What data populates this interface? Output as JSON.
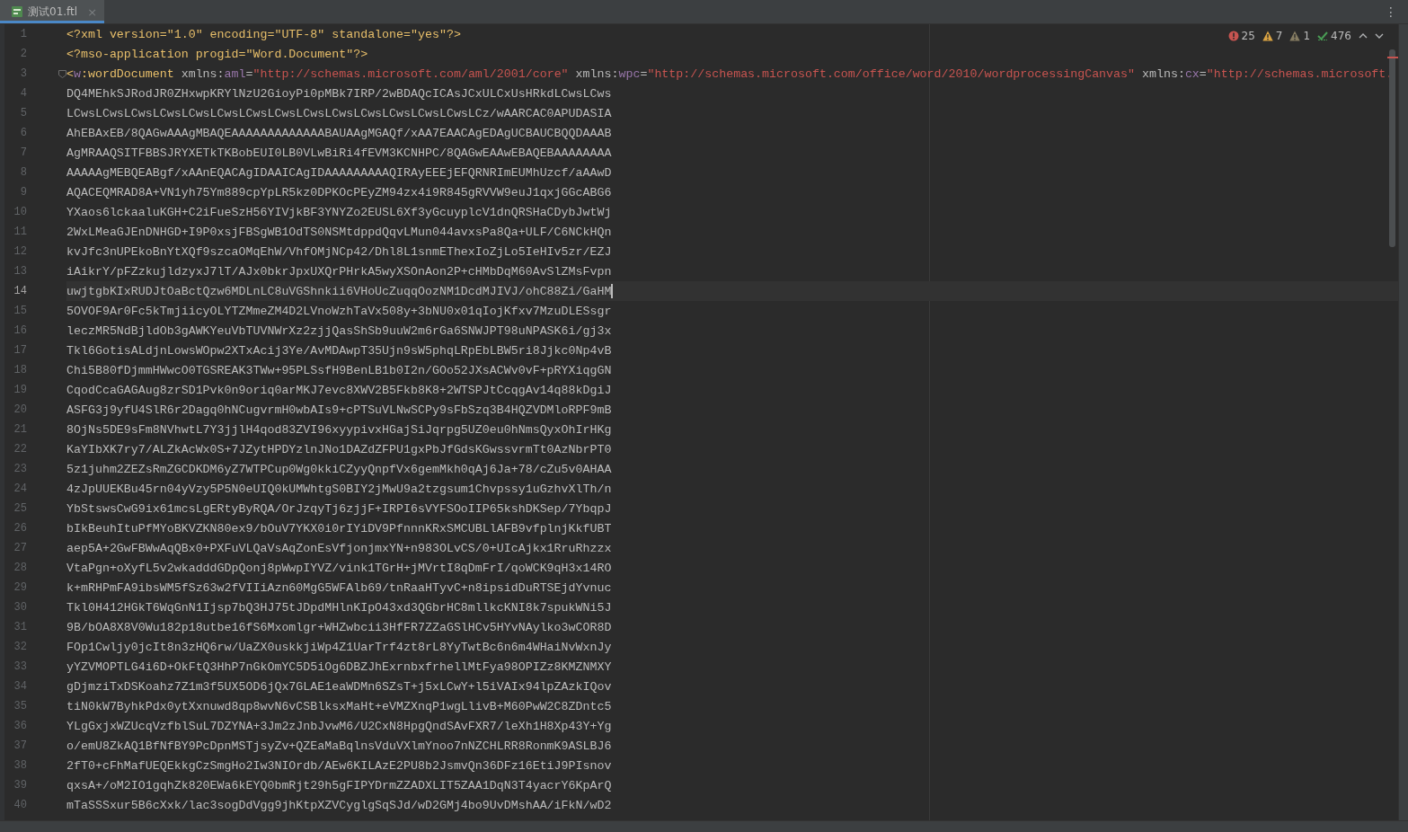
{
  "tabs": [
    {
      "title": "测试01.ftl",
      "selected": true,
      "close": "×"
    }
  ],
  "menu": "⋮",
  "inspections": [
    {
      "kind": "error",
      "count": "25"
    },
    {
      "kind": "warning",
      "count": "7"
    },
    {
      "kind": "weak",
      "count": "1"
    },
    {
      "kind": "ok",
      "count": "476"
    }
  ],
  "lines": [
    {
      "number": "1",
      "current": false,
      "tokens": [
        {
          "kind": "pi",
          "text": "<?xml version=\"1.0\" encoding=\"UTF-8\" standalone=\"yes\"?>"
        }
      ]
    },
    {
      "number": "2",
      "current": false,
      "tokens": [
        {
          "kind": "pi",
          "text": "<?mso-application progid=\"Word.Document\"?>"
        }
      ]
    },
    {
      "number": "3",
      "current": false,
      "fold": true,
      "tokens": [
        {
          "kind": "tag",
          "text": "<"
        },
        {
          "kind": "ns",
          "text": "w"
        },
        {
          "kind": "tag",
          "text": ":wordDocument"
        },
        {
          "kind": "plain",
          "text": " xmlns:"
        },
        {
          "kind": "ns",
          "text": "aml"
        },
        {
          "kind": "plain",
          "text": "="
        },
        {
          "kind": "url",
          "text": "\"http://schemas.microsoft.com/aml/2001/core\""
        },
        {
          "kind": "plain",
          "text": " xmlns:"
        },
        {
          "kind": "ns",
          "text": "wpc"
        },
        {
          "kind": "plain",
          "text": "="
        },
        {
          "kind": "url",
          "text": "\"http://schemas.microsoft.com/office/word/2010/wordprocessingCanvas\""
        },
        {
          "kind": "plain",
          "text": " xmlns:"
        },
        {
          "kind": "ns",
          "text": "cx"
        },
        {
          "kind": "plain",
          "text": "="
        },
        {
          "kind": "url",
          "text": "\"http://schemas.microsoft."
        }
      ]
    },
    {
      "number": "4",
      "current": false,
      "tokens": [
        {
          "kind": "plain",
          "text": "DQ4MEhkSJRodJR0ZHxwpKRYlNzU2GioyPi0pMBk7IRP/2wBDAQcICAsJCxULCxUsHRkdLCwsLCws"
        }
      ]
    },
    {
      "number": "5",
      "current": false,
      "tokens": [
        {
          "kind": "plain",
          "text": "LCwsLCwsLCwsLCwsLCwsLCwsLCwsLCwsLCwsLCwsLCwsLCwsLCwsLCwsLCz/wAARCAC0APUDASIA"
        }
      ]
    },
    {
      "number": "6",
      "current": false,
      "tokens": [
        {
          "kind": "plain",
          "text": "AhEBAxEB/8QAGwAAAgMBAQEAAAAAAAAAAAAABAUAAgMGAQf/xAA7EAACAgEDAgUCBAUCBQQDAAAB"
        }
      ]
    },
    {
      "number": "7",
      "current": false,
      "tokens": [
        {
          "kind": "plain",
          "text": "AgMRAAQSITFBBSJRYXETkTKBobEUI0LB0VLwBiRi4fEVM3KCNHPC/8QAGwEAAwEBAQEBAAAAAAAA"
        }
      ]
    },
    {
      "number": "8",
      "current": false,
      "tokens": [
        {
          "kind": "plain",
          "text": "AAAAAgMEBQEABgf/xAAnEQACAgIDAAICAgIDAAAAAAAAAQIRAyEEEjEFQRNRImEUMhUzcf/aAAwD"
        }
      ]
    },
    {
      "number": "9",
      "current": false,
      "tokens": [
        {
          "kind": "plain",
          "text": "AQACEQMRAD8A+VN1yh75Ym889cpYpLR5kz0DPKOcPEyZM94zx4i9R845gRVVW9euJ1qxjGGcABG6"
        }
      ]
    },
    {
      "number": "10",
      "current": false,
      "tokens": [
        {
          "kind": "plain",
          "text": "YXaos6lckaaluKGH+C2iFueSzH56YIVjkBF3YNYZo2EUSL6Xf3yGcuyplcV1dnQRSHaCDybJwtWj"
        }
      ]
    },
    {
      "number": "11",
      "current": false,
      "tokens": [
        {
          "kind": "plain",
          "text": "2WxLMeaGJEnDNHGD+I9P0xsjFBSgWB1OdTS0NSMtdppdQqvLMun044avxsPa8Qa+ULF/C6NCkHQn"
        }
      ]
    },
    {
      "number": "12",
      "current": false,
      "tokens": [
        {
          "kind": "plain",
          "text": "kvJfc3nUPEkoBnYtXQf9szcaOMqEhW/VhfOMjNCp42/Dhl8L1snmEThexIoZjLo5IeHIv5zr/EZJ"
        }
      ]
    },
    {
      "number": "13",
      "current": false,
      "tokens": [
        {
          "kind": "plain",
          "text": "iAikrY/pFZzkujldzyxJ7lT/AJx0bkrJpxUXQrPHrkA5wyXSOnAon2P+cHMbDqM60AvSlZMsFvpn"
        }
      ]
    },
    {
      "number": "14",
      "current": true,
      "tokens": [
        {
          "kind": "plain",
          "text": "uwjtgbKIxRUDJtOaBctQzw6MDLnLC8uVGShnkii6VHoUcZuqqOozNM1DcdMJIVJ/ohC88Zi/GaHM"
        }
      ]
    },
    {
      "number": "15",
      "current": false,
      "tokens": [
        {
          "kind": "plain",
          "text": "5OVOF9Ar0Fc5kTmjiicyOLYTZMmeZM4D2LVnoWzhTaVx508y+3bNU0x01qIojKfxv7MzuDLESsgr"
        }
      ]
    },
    {
      "number": "16",
      "current": false,
      "tokens": [
        {
          "kind": "plain",
          "text": "leczMR5NdBjldOb3gAWKYeuVbTUVNWrXz2zjjQasShSb9uuW2m6rGa6SNWJPT98uNPASK6i/gj3x"
        }
      ]
    },
    {
      "number": "17",
      "current": false,
      "tokens": [
        {
          "kind": "plain",
          "text": "Tkl6GotisALdjnLowsWOpw2XTxAcij3Ye/AvMDAwpT35Ujn9sW5phqLRpEbLBW5ri8Jjkc0Np4vB"
        }
      ]
    },
    {
      "number": "18",
      "current": false,
      "tokens": [
        {
          "kind": "plain",
          "text": "Chi5B80fDjmmHWwcO0TGSREAK3TWw+95PLSsfH9BenLB1b0I2n/GOo52JXsACWv0vF+pRYXiqgGN"
        }
      ]
    },
    {
      "number": "19",
      "current": false,
      "tokens": [
        {
          "kind": "plain",
          "text": "CqodCcaGAGAug8zrSD1Pvk0n9oriq0arMKJ7evc8XWV2B5Fkb8K8+2WTSPJtCcqgAv14q88kDgiJ"
        }
      ]
    },
    {
      "number": "20",
      "current": false,
      "tokens": [
        {
          "kind": "plain",
          "text": "ASFG3j9yfU4SlR6r2Dagq0hNCugvrmH0wbAIs9+cPTSuVLNwSCPy9sFbSzq3B4HQZVDMloRPF9mB"
        }
      ]
    },
    {
      "number": "21",
      "current": false,
      "tokens": [
        {
          "kind": "plain",
          "text": "8OjNs5DE9sFm8NVhwtL7Y3jjlH4qod83ZVI96xyypivxHGajSiJqrpg5UZ0eu0hNmsQyxOhIrHKg"
        }
      ]
    },
    {
      "number": "22",
      "current": false,
      "tokens": [
        {
          "kind": "plain",
          "text": "KaYIbXK7ry7/ALZkAcWx0S+7JZytHPDYzlnJNo1DAZdZFPU1gxPbJfGdsKGwssvrmTt0AzNbrPT0"
        }
      ]
    },
    {
      "number": "23",
      "current": false,
      "tokens": [
        {
          "kind": "plain",
          "text": "5z1juhm2ZEZsRmZGCDKDM6yZ7WTPCup0Wg0kkiCZyyQnpfVx6gemMkh0qAj6Ja+78/cZu5v0AHAA"
        }
      ]
    },
    {
      "number": "24",
      "current": false,
      "tokens": [
        {
          "kind": "plain",
          "text": "4zJpUUEKBu45rn04yVzy5P5N0eUIQ0kUMWhtgS0BIY2jMwU9a2tzgsum1Chvpssy1uGzhvXlTh/n"
        }
      ]
    },
    {
      "number": "25",
      "current": false,
      "tokens": [
        {
          "kind": "plain",
          "text": "YbStswsCwG9ix61mcsLgERtyByRQA/OrJzqyTj6zjjF+IRPI6sVYFSOoIIP65kshDKSep/7YbqpJ"
        }
      ]
    },
    {
      "number": "26",
      "current": false,
      "tokens": [
        {
          "kind": "plain",
          "text": "bIkBeuhItuPfMYoBKVZKN80ex9/bOuV7YKX0i0rIYiDV9PfnnnKRxSMCUBLlAFB9vfplnjKkfUBT"
        }
      ]
    },
    {
      "number": "27",
      "current": false,
      "tokens": [
        {
          "kind": "plain",
          "text": "aep5A+2GwFBWwAqQBx0+PXFuVLQaVsAqZonEsVfjonjmxYN+n983OLvCS/0+UIcAjkx1RruRhzzx"
        }
      ]
    },
    {
      "number": "28",
      "current": false,
      "tokens": [
        {
          "kind": "plain",
          "text": "VtaPgn+oXyfL5v2wkadddGDpQonj8pWwpIYVZ/vink1TGrH+jMVrtI8qDmFrI/qoWCK9qH3x14RO"
        }
      ]
    },
    {
      "number": "29",
      "current": false,
      "tokens": [
        {
          "kind": "plain",
          "text": "k+mRHPmFA9ibsWM5fSz63w2fVIIiAzn60MgG5WFAlb69/tnRaaHTyvC+n8ipsidDuRTSEjdYvnuc"
        }
      ]
    },
    {
      "number": "30",
      "current": false,
      "tokens": [
        {
          "kind": "plain",
          "text": "Tkl0H412HGkT6WqGnN1Ijsp7bQ3HJ75tJDpdMHlnKIpO43xd3QGbrHC8mllkcKNI8k7spukWNi5J"
        }
      ]
    },
    {
      "number": "31",
      "current": false,
      "tokens": [
        {
          "kind": "plain",
          "text": "9B/bOA8X8V0Wu182p18utbe16fS6Mxomlgr+WHZwbcii3HfFR7ZZaGSlHCv5HYvNAylko3wCOR8D"
        }
      ]
    },
    {
      "number": "32",
      "current": false,
      "tokens": [
        {
          "kind": "plain",
          "text": "FOp1Cwljy0jcIt8n3zHQ6rw/UaZX0uskkjiWp4Z1UarTrf4zt8rL8YyTwtBc6n6m4WHaiNvWxnJy"
        }
      ]
    },
    {
      "number": "33",
      "current": false,
      "tokens": [
        {
          "kind": "plain",
          "text": "yYZVMOPTLG4i6D+OkFtQ3HhP7nGkOmYC5D5iOg6DBZJhExrnbxfrhellMtFya98OPIZz8KMZNMXY"
        }
      ]
    },
    {
      "number": "34",
      "current": false,
      "tokens": [
        {
          "kind": "plain",
          "text": "gDjmziTxDSKoahz7Z1m3f5UX5OD6jQx7GLAE1eaWDMn6SZsT+j5xLCwY+l5iVAIx94lpZAzkIQov"
        }
      ]
    },
    {
      "number": "35",
      "current": false,
      "tokens": [
        {
          "kind": "plain",
          "text": "tiN0kW7ByhkPdx0ytXxnuwd8qp8wvN6vCSBlksxMaHt+eVMZXnqP1wgLlivB+M60PwW2C8ZDntc5"
        }
      ]
    },
    {
      "number": "36",
      "current": false,
      "tokens": [
        {
          "kind": "plain",
          "text": "YLgGxjxWZUcqVzfblSuL7DZYNA+3Jm2zJnbJvwM6/U2CxN8HpgQndSAvFXR7/leXh1H8Xp43Y+Yg"
        }
      ]
    },
    {
      "number": "37",
      "current": false,
      "tokens": [
        {
          "kind": "plain",
          "text": "o/emU8ZkAQ1BfNfBY9PcDpnMSTjsyZv+QZEaMaBqlnsVduVXlmYnoo7nNZCHLRR8RonmK9ASLBJ6"
        }
      ]
    },
    {
      "number": "38",
      "current": false,
      "tokens": [
        {
          "kind": "plain",
          "text": "2fT0+cFhMafUEQEkkgCzSmgHo2Iw3NIOrdb/AEw6KILAzE2PU8b2JsmvQn36DFz16EtiJ9PIsnov"
        }
      ]
    },
    {
      "number": "39",
      "current": false,
      "tokens": [
        {
          "kind": "plain",
          "text": "qxsA+/oM2IO1gqhZk820EWa6kEYQ0bmRjt29h5gFIPYDrmZZADXLIT5ZAA1DqN3T4yacrY6KpArQ"
        }
      ]
    },
    {
      "number": "40",
      "current": false,
      "tokens": [
        {
          "kind": "plain",
          "text": "mTaSSSxur5B6cXxk/lac3sogDdVgg9jhKtpXZVCyglgSqSJd/wD2GMj4bo9UvDMshAA/iFkN/wD2"
        }
      ]
    }
  ]
}
